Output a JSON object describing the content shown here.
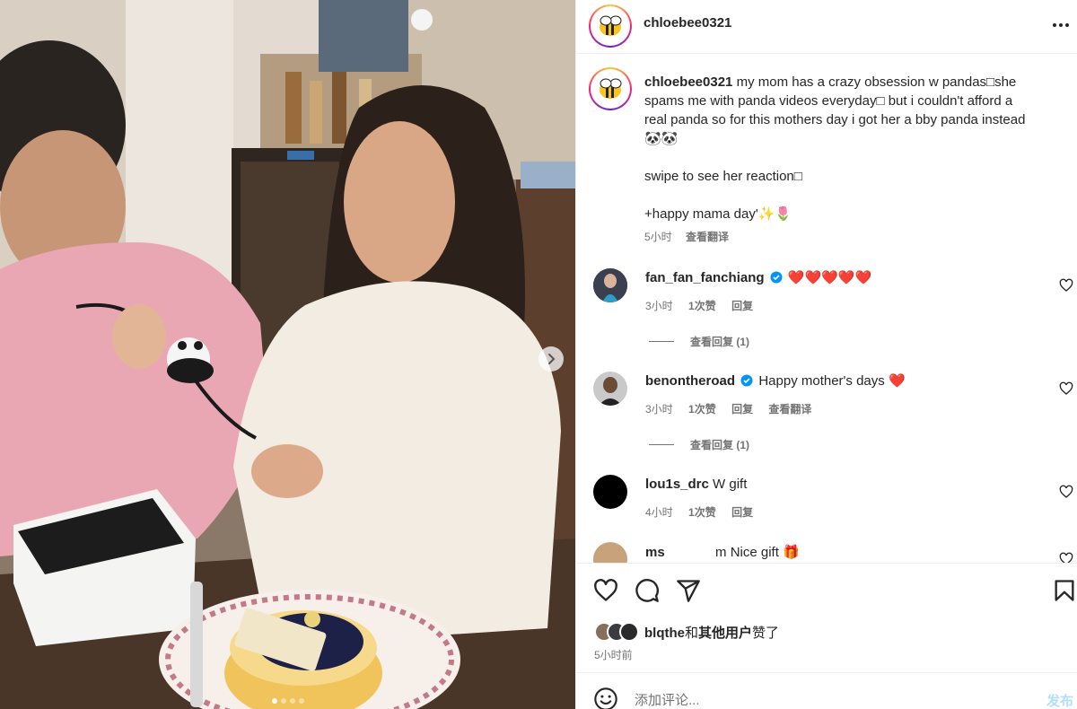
{
  "colors": {
    "accent": "#0095f6",
    "post_disabled": "#b2dffc",
    "heart_red": "#ed1c3a",
    "verified_blue": "#0095f6",
    "secondary_text": "#737373"
  },
  "media": {
    "carousel_dot_count": 4,
    "active_dot": 0,
    "icons": {
      "next": "chevron-right-icon"
    }
  },
  "header": {
    "username": "chloebee0321",
    "icons": {
      "avatar": "bee-avatar",
      "more": "more-options-icon"
    }
  },
  "caption": {
    "username": "chloebee0321",
    "lines": [
      "my mom has a crazy obsession w pandas□she",
      "spams me with panda videos everyday□ but i couldn't afford a",
      "real panda so for this mothers day i got her a bby panda instead",
      "🐼🐼",
      "",
      "swipe to see her reaction□",
      "",
      "+happy mama day'✨🌷"
    ],
    "time": "5小时",
    "translate": "查看翻译"
  },
  "comments": [
    {
      "username": "fan_fan_fanchiang",
      "verified": true,
      "text": "❤️❤️❤️❤️❤️",
      "time": "3小时",
      "likes": "1次赞",
      "reply": "回复",
      "translate": "",
      "view_replies": "查看回复 (1)"
    },
    {
      "username": "benontheroad",
      "verified": true,
      "text": "Happy mother's days ❤️",
      "time": "3小时",
      "likes": "1次赞",
      "reply": "回复",
      "translate": "查看翻译",
      "view_replies": "查看回复 (1)"
    },
    {
      "username": "lou1s_drc",
      "verified": false,
      "text": "W gift",
      "time": "4小时",
      "likes": "1次赞",
      "reply": "回复",
      "translate": "",
      "view_replies": ""
    },
    {
      "username": "ms",
      "verified": false,
      "text": "m Nice gift 🎁",
      "time": "",
      "likes": "",
      "reply": "",
      "translate": "",
      "view_replies": ""
    }
  ],
  "actions": {
    "icons": [
      "heart-icon",
      "comment-icon",
      "share-icon",
      "bookmark-icon"
    ]
  },
  "likes": {
    "user": "blqthe",
    "connector": "和",
    "others": "其他用户",
    "suffix": "赞了"
  },
  "post_time": "5小时前",
  "comment_box": {
    "placeholder": "添加评论...",
    "post_label": "发布",
    "icons": {
      "emoji": "emoji-icon"
    }
  }
}
